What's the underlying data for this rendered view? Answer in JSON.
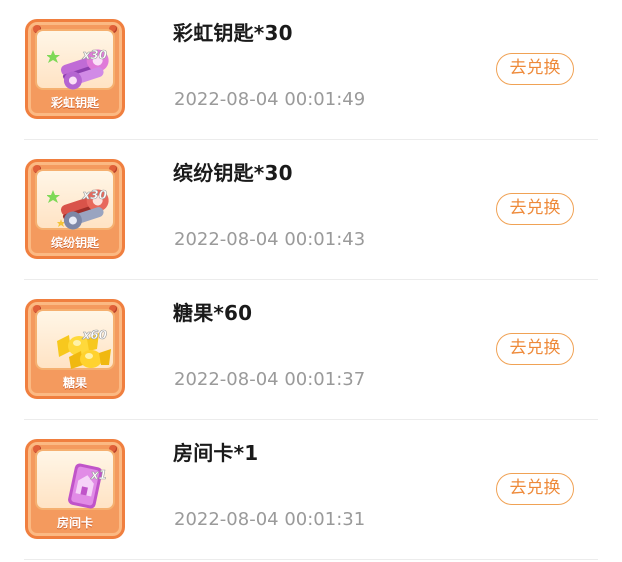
{
  "items": [
    {
      "title": "彩虹钥匙*30",
      "card_label": "彩虹钥匙",
      "qty": "x30",
      "time": "2022-08-04 00:01:49",
      "button": "去兑换",
      "art": "rainbow-key-icon"
    },
    {
      "title": "缤纷钥匙*30",
      "card_label": "缤纷钥匙",
      "qty": "x30",
      "time": "2022-08-04 00:01:43",
      "button": "去兑换",
      "art": "colorful-key-icon"
    },
    {
      "title": "糖果*60",
      "card_label": "糖果",
      "qty": "x60",
      "time": "2022-08-04 00:01:37",
      "button": "去兑换",
      "art": "candy-icon"
    },
    {
      "title": "房间卡*1",
      "card_label": "房间卡",
      "qty": "x1",
      "time": "2022-08-04 00:01:31",
      "button": "去兑换",
      "art": "room-card-icon"
    }
  ],
  "colors": {
    "accent": "#ee8a3a",
    "card": "#f49a5e",
    "time": "#9a9a9a"
  }
}
